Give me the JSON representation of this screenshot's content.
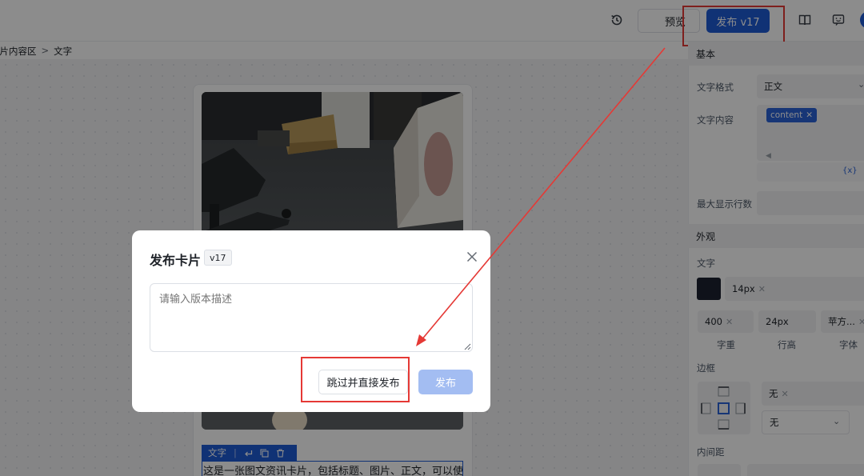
{
  "topbar": {
    "preview_label": "预览",
    "publish_label": "发布 v17",
    "icons": [
      "history-icon",
      "book-icon",
      "chat-icon",
      "avatar"
    ]
  },
  "breadcrumb": {
    "parent": "卡片内容区",
    "separator": ">",
    "current": "文字"
  },
  "card": {
    "toolbar_label": "文字",
    "text_preview": "这是一张图文资讯卡片，包括标题、图片、正文，可以使"
  },
  "panel": {
    "basic_section": "基本",
    "text_format_label": "文字格式",
    "text_format_value": "正文",
    "text_content_label": "文字内容",
    "text_content_tag": "content",
    "var_button": "{x}",
    "max_lines_label": "最大显示行数",
    "appearance_section": "外观",
    "text_label": "文字",
    "text_color": "#1c2230",
    "font_size": "14px",
    "font_weight": "400",
    "line_height": "24px",
    "font_family": "苹方...",
    "weight_caption": "字重",
    "line_height_caption": "行高",
    "font_caption": "字体",
    "border_label": "边框",
    "border_value": "无",
    "border_style_value": "无",
    "padding_label": "内间距"
  },
  "modal": {
    "title": "发布卡片",
    "version_badge": "v17",
    "placeholder": "请输入版本描述",
    "skip_label": "跳过并直接发布",
    "confirm_label": "发布"
  },
  "colors": {
    "primary": "#1e5bd6",
    "primary_disabled": "#a3bdf2",
    "annotation_red": "#e53935"
  }
}
